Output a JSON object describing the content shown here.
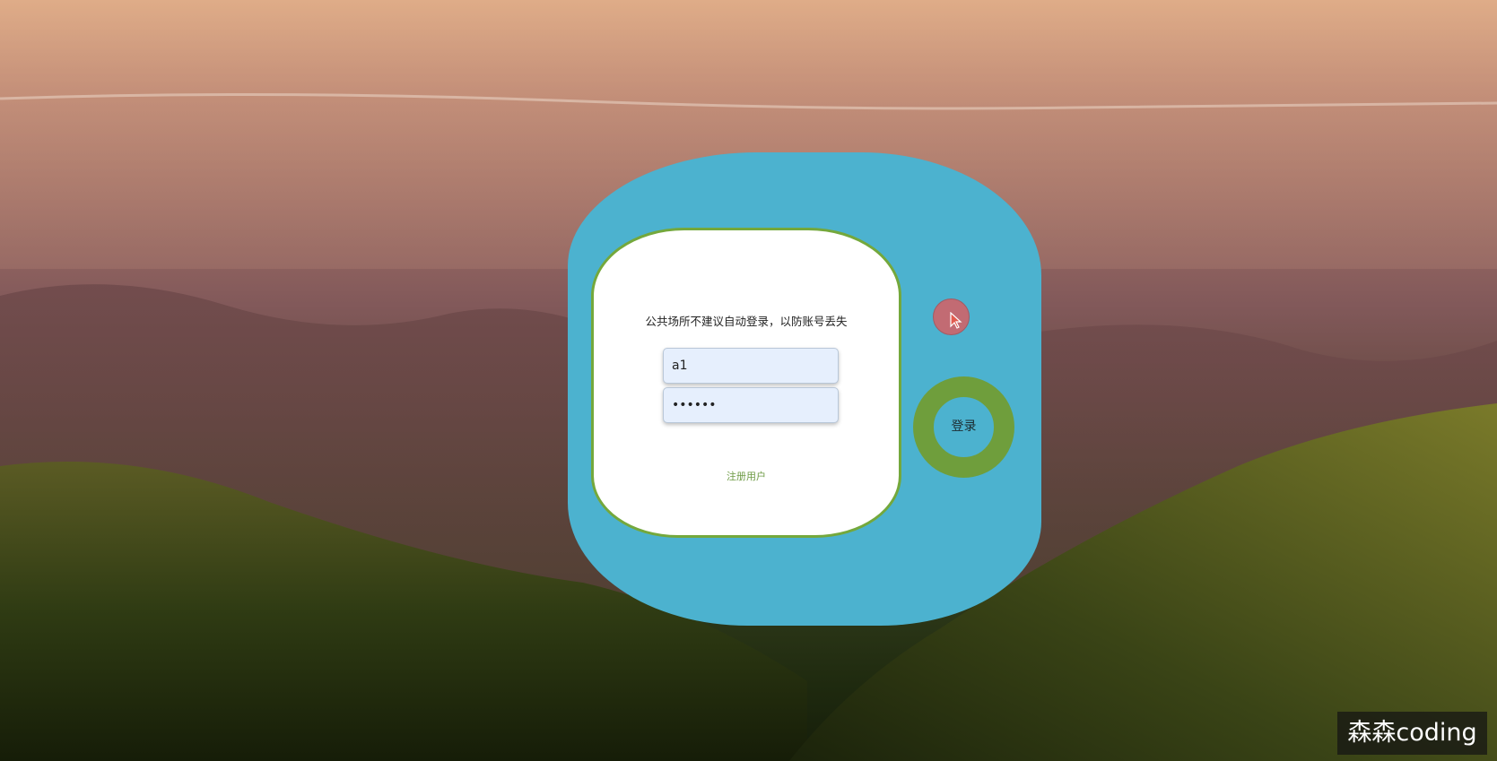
{
  "login": {
    "notice": "公共场所不建议自动登录，以防账号丢失",
    "username_value": "a1",
    "password_masked": "••••••",
    "register_link": "注册用户",
    "login_button": "登录"
  },
  "watermark": "森森coding",
  "colors": {
    "card": "#4cb2cf",
    "inner_border": "#74a83c",
    "ring": "#6f9e3c",
    "dot": "#c26b73",
    "field_bg": "#e6effd"
  }
}
